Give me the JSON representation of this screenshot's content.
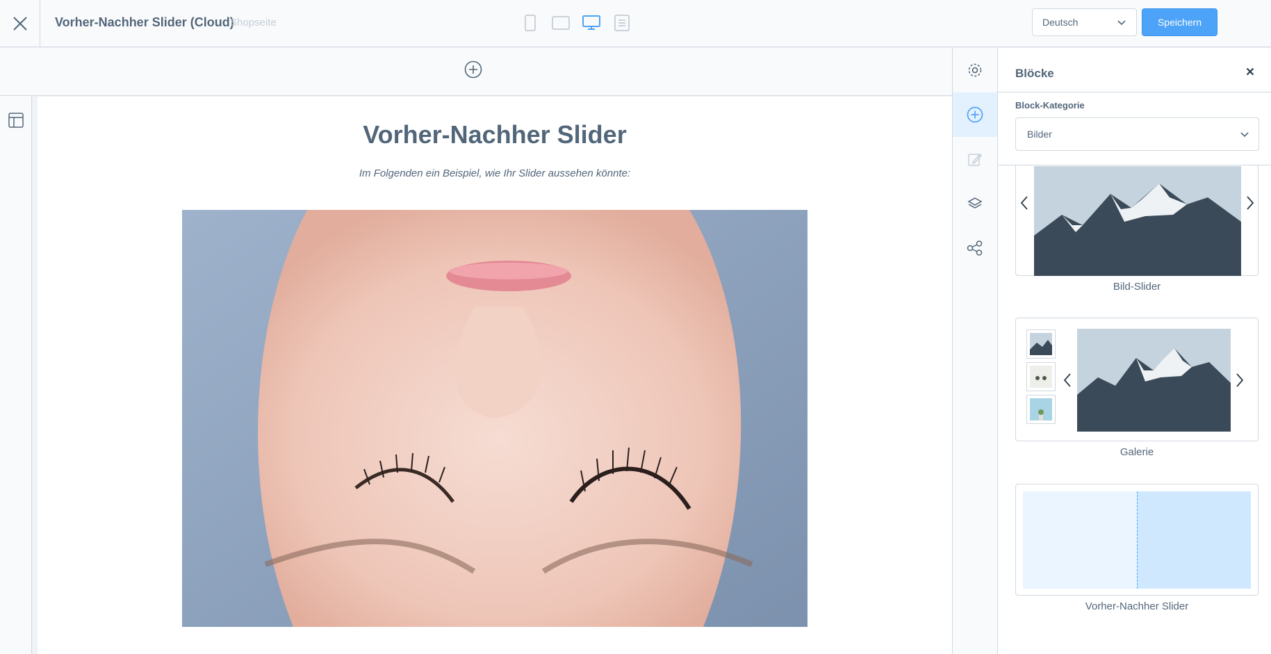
{
  "header": {
    "close_icon": "close-icon",
    "title": "Vorher-Nachher Slider (Cloud)",
    "page_type": "Shopseite",
    "devices": [
      "mobile-icon",
      "tablet-icon",
      "desktop-icon",
      "list-icon"
    ],
    "active_device": "desktop",
    "language": "Deutsch",
    "save_label": "Speichern",
    "accent_color": "#4da3f7"
  },
  "left_rail": {
    "icon": "layout-icon"
  },
  "canvas": {
    "add_section_icon": "plus-circle-icon",
    "title": "Vorher-Nachher Slider",
    "subtitle": "Im Folgenden ein Beispiel, wie Ihr Slider aussehen könnte:"
  },
  "sidebar_icons": [
    "gear-icon",
    "plus-circle-icon",
    "edit-icon",
    "layers-icon",
    "share-icon"
  ],
  "blocks_panel": {
    "title": "Blöcke",
    "category_label": "Block-Kategorie",
    "category_value": "Bilder",
    "blocks": [
      {
        "label": "Bild-Slider"
      },
      {
        "label": "Galerie"
      },
      {
        "label": "Vorher-Nachher Slider"
      }
    ]
  }
}
